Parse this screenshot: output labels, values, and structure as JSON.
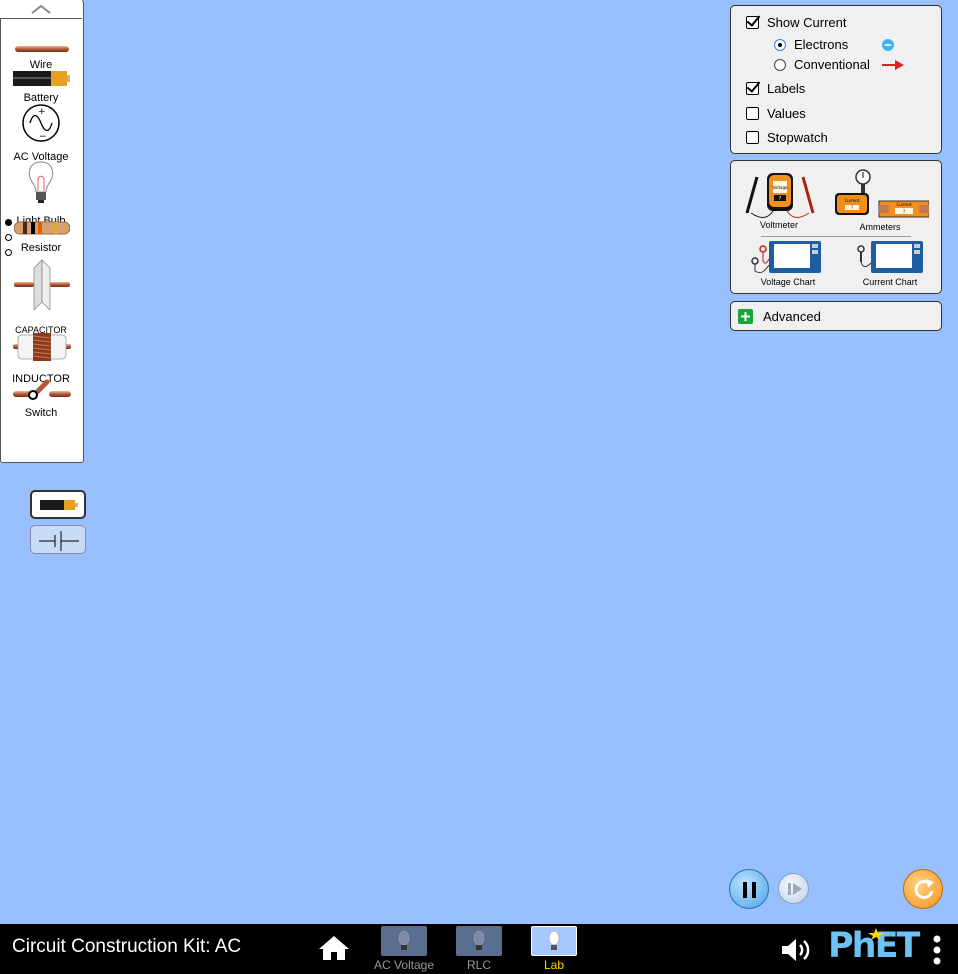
{
  "toolbox": {
    "items": [
      {
        "label": "Wire",
        "icon": "wire-icon"
      },
      {
        "label": "Battery",
        "icon": "battery-icon"
      },
      {
        "label": "AC Voltage",
        "icon": "ac-voltage-icon"
      },
      {
        "label": "Light Bulb",
        "icon": "light-bulb-icon"
      },
      {
        "label": "Resistor",
        "icon": "resistor-icon"
      },
      {
        "label": "CAPACITOR",
        "icon": "capacitor-icon"
      },
      {
        "label": "INDUCTOR",
        "icon": "inductor-icon"
      },
      {
        "label": "Switch",
        "icon": "switch-icon"
      }
    ]
  },
  "display_options": {
    "show_current": {
      "label": "Show Current",
      "checked": true
    },
    "electrons": {
      "label": "Electrons",
      "selected": true
    },
    "conventional": {
      "label": "Conventional",
      "selected": false
    },
    "labels": {
      "label": "Labels",
      "checked": true
    },
    "values": {
      "label": "Values",
      "checked": false
    },
    "stopwatch": {
      "label": "Stopwatch",
      "checked": false
    }
  },
  "sensors": {
    "voltmeter": "Voltmeter",
    "ammeters": "Ammeters",
    "voltage_chart": "Voltage Chart",
    "current_chart": "Current Chart",
    "meter_voltage_text": "Voltage",
    "meter_current_text": "Current",
    "meter_unknown": "?"
  },
  "advanced": {
    "label": "Advanced"
  },
  "navbar": {
    "title": "Circuit Construction Kit: AC",
    "screens": [
      {
        "label": "AC Voltage",
        "selected": false
      },
      {
        "label": "RLC",
        "selected": false
      },
      {
        "label": "Lab",
        "selected": true
      }
    ],
    "brand": "PhET"
  },
  "colors": {
    "background": "#99c0fe",
    "panel": "#f0f0f0",
    "accent_selected": "#ffd700",
    "reset_orange": "#f7941d"
  }
}
